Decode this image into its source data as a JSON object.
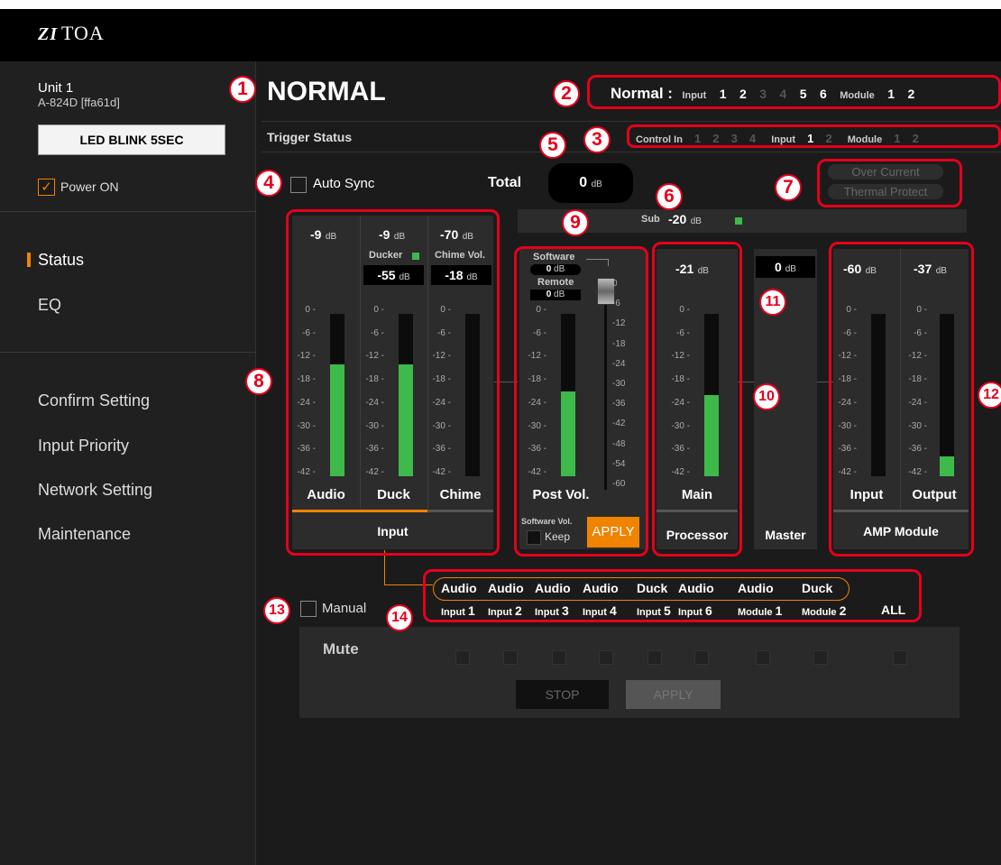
{
  "brand": {
    "logo": "TOA"
  },
  "sidebar": {
    "unit": "Unit 1",
    "model": "A-824D [ffa61d]",
    "led_button": "LED BLINK 5SEC",
    "power": "Power ON",
    "power_check": "✓",
    "nav": [
      "Status",
      "EQ"
    ],
    "menu": [
      "Confirm Setting",
      "Input Priority",
      "Network Setting",
      "Maintenance"
    ]
  },
  "status": {
    "title": "NORMAL",
    "trigger": "Trigger Status",
    "normal_label": "Normal :",
    "normal_input_label": "Input",
    "normal_inputs": [
      "1",
      "2",
      "3",
      "4",
      "5",
      "6"
    ],
    "normal_module_label": "Module",
    "normal_modules": [
      "1",
      "2"
    ],
    "control_in_label": "Control In",
    "control_in": [
      "1",
      "2",
      "3",
      "4"
    ],
    "ci_input_label": "Input",
    "ci_inputs": [
      "1",
      "2"
    ],
    "ci_module_label": "Module",
    "ci_modules": [
      "1",
      "2"
    ]
  },
  "sync": {
    "label": "Auto Sync"
  },
  "total": {
    "label": "Total",
    "value": "0",
    "unit": "dB"
  },
  "protect": {
    "over": "Over Current",
    "thermal": "Thermal Protect"
  },
  "sub": {
    "label": "Sub",
    "value": "-20",
    "unit": "dB"
  },
  "scale": [
    "0",
    "-6",
    "-12",
    "-18",
    "-24",
    "-30",
    "-36",
    "-42"
  ],
  "fader_scale": [
    "0",
    "-6",
    "-12",
    "-18",
    "-24",
    "-30",
    "-36",
    "-42",
    "-48",
    "-54",
    "-60"
  ],
  "input": {
    "label": "Input",
    "audio": {
      "value": "-9",
      "unit": "dB",
      "name": "Audio",
      "level": 0.69
    },
    "duck": {
      "value": "-9",
      "unit": "dB",
      "name": "Duck",
      "level": 0.69,
      "ducker": "Ducker",
      "ducker_val": "-55",
      "ducker_unit": "dB"
    },
    "chime": {
      "value": "-70",
      "unit": "dB",
      "name": "Chime",
      "level": 0.0,
      "vol_label": "Chime Vol.",
      "vol_val": "-18",
      "vol_unit": "dB"
    }
  },
  "post": {
    "software": "Software",
    "software_val": "0",
    "software_unit": "dB",
    "remote": "Remote",
    "remote_val": "0",
    "remote_unit": "dB",
    "name": "Post Vol.",
    "level": 0.52,
    "sw_vol": "Software Vol.",
    "keep": "Keep",
    "apply": "APPLY"
  },
  "processor": {
    "value": "-21",
    "unit": "dB",
    "name": "Main",
    "level": 0.5,
    "label": "Processor"
  },
  "master": {
    "value": "0",
    "unit": "dB",
    "label": "Master"
  },
  "amp": {
    "label": "AMP Module",
    "input": {
      "value": "-60",
      "unit": "dB",
      "name": "Input",
      "level": 0.0
    },
    "output": {
      "value": "-37",
      "unit": "dB",
      "name": "Output",
      "level": 0.12
    }
  },
  "routing": {
    "types": [
      "Audio",
      "Audio",
      "Audio",
      "Audio",
      "Duck",
      "Audio",
      "Audio",
      "Duck"
    ],
    "sources": [
      {
        "a": "Input",
        "b": "1"
      },
      {
        "a": "Input",
        "b": "2"
      },
      {
        "a": "Input",
        "b": "3"
      },
      {
        "a": "Input",
        "b": "4"
      },
      {
        "a": "Input",
        "b": "5"
      },
      {
        "a": "Input",
        "b": "6"
      },
      {
        "a": "Module",
        "b": "1"
      },
      {
        "a": "Module",
        "b": "2"
      }
    ],
    "all": "ALL",
    "manual": "Manual"
  },
  "mute": {
    "label": "Mute",
    "stop": "STOP",
    "apply": "APPLY"
  },
  "callouts": [
    "1",
    "2",
    "3",
    "4",
    "5",
    "6",
    "7",
    "8",
    "9",
    "10",
    "11",
    "12",
    "13",
    "14"
  ]
}
